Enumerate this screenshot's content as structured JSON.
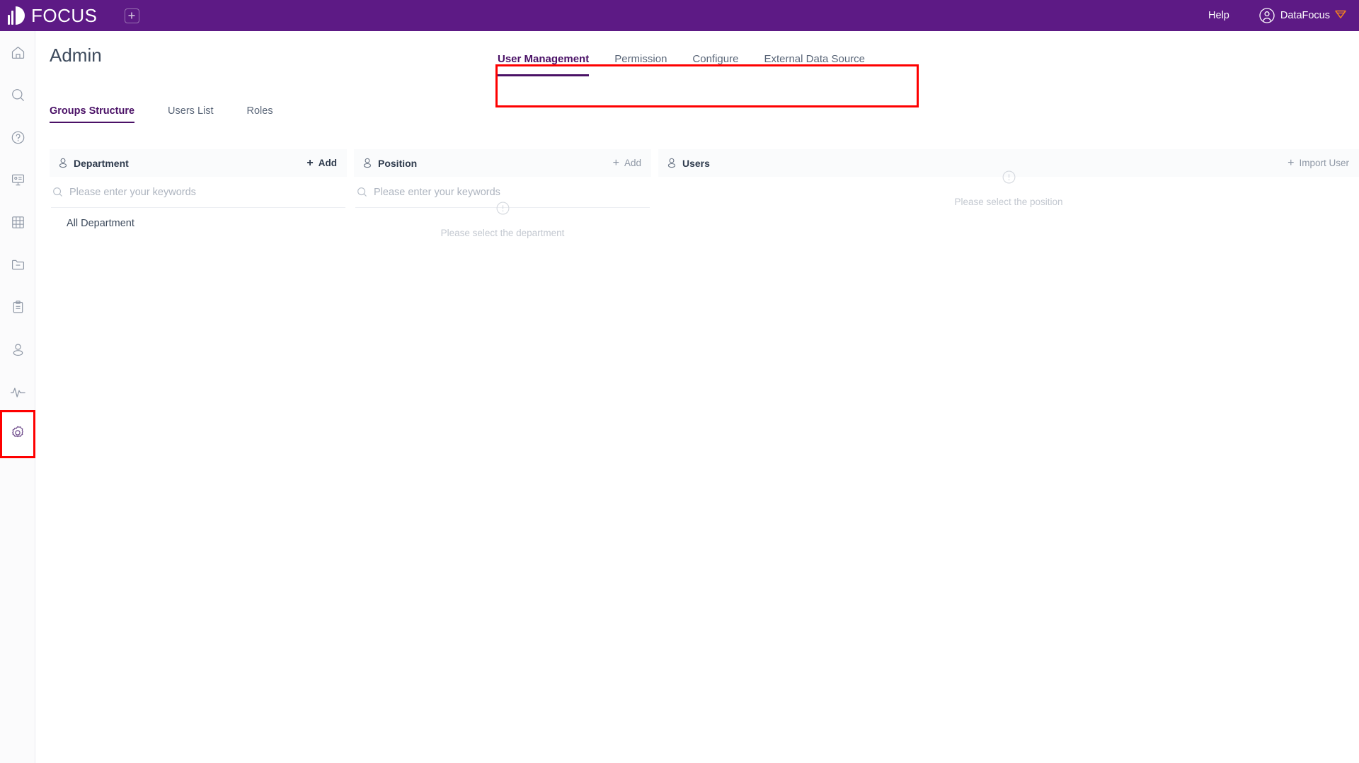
{
  "topbar": {
    "brand": "FOCUS",
    "add_tab_icon": "plus-square-icon",
    "help_label": "Help",
    "user_name": "DataFocus",
    "user_avatar_icon": "user-circle-icon",
    "crown_icon": "crown-icon",
    "bg_color": "#5d1a85"
  },
  "sidebar": {
    "items": [
      {
        "icon": "home-icon",
        "name": "home"
      },
      {
        "icon": "search-icon",
        "name": "search"
      },
      {
        "icon": "question-icon",
        "name": "help"
      },
      {
        "icon": "presentation-icon",
        "name": "dashboard"
      },
      {
        "icon": "grid-icon",
        "name": "table"
      },
      {
        "icon": "folder-icon",
        "name": "resources"
      },
      {
        "icon": "clipboard-icon",
        "name": "tasks"
      },
      {
        "icon": "user-icon",
        "name": "profile"
      },
      {
        "icon": "pulse-icon",
        "name": "monitor"
      },
      {
        "icon": "gear-icon",
        "name": "admin"
      }
    ],
    "active_index": 9,
    "highlight_color": "#fe0000"
  },
  "page": {
    "title": "Admin",
    "accent_color": "#4a1166",
    "highlight_color": "#fe0000"
  },
  "primary_tabs": {
    "items": [
      {
        "label": "User Management"
      },
      {
        "label": "Permission"
      },
      {
        "label": "Configure"
      },
      {
        "label": "External Data Source"
      }
    ],
    "active_index": 0
  },
  "sub_tabs": {
    "items": [
      {
        "label": "Groups Structure"
      },
      {
        "label": "Users List"
      },
      {
        "label": "Roles"
      }
    ],
    "active_index": 0
  },
  "department_panel": {
    "icon": "user-outline-icon",
    "title": "Department",
    "action_label": "Add",
    "action_icon": "plus-icon",
    "search_placeholder": "Please enter your keywords",
    "search_value": "",
    "search_icon": "search-icon",
    "tree": [
      {
        "label": "All Department"
      }
    ]
  },
  "position_panel": {
    "icon": "user-outline-icon",
    "title": "Position",
    "action_label": "Add",
    "action_icon": "plus-icon",
    "search_placeholder": "Please enter your keywords",
    "search_value": "",
    "search_icon": "search-icon",
    "empty_icon": "exclamation-circle-icon",
    "empty_text": "Please select the department"
  },
  "users_panel": {
    "icon": "user-outline-icon",
    "title": "Users",
    "action_label": "Import User",
    "action_icon": "plus-icon",
    "empty_icon": "exclamation-circle-icon",
    "empty_text": "Please select the position"
  }
}
